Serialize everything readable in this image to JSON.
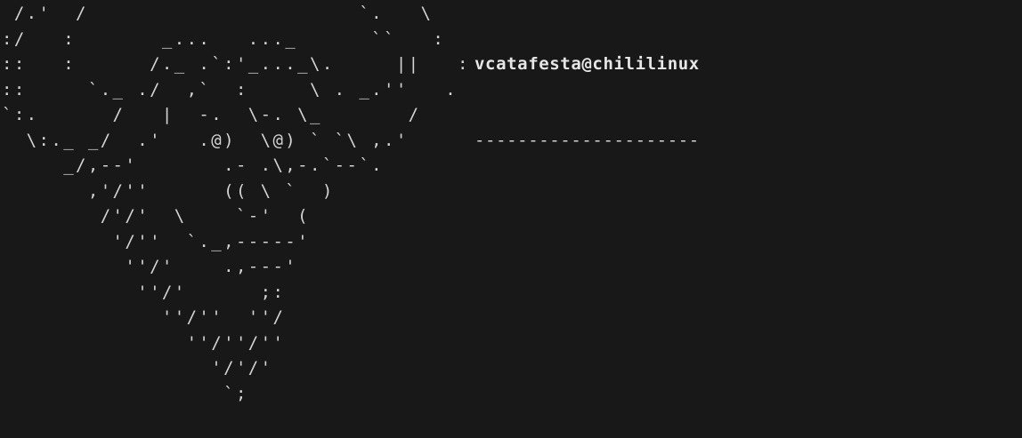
{
  "terminal": {
    "logo_lines": [
      " /.'  /                      `.   \\",
      ":/   :       _...   ..._      ``   :",
      "::   :      /._ .`:'_..._\\.     ||   :",
      "::     `._ ./  ,`  :     \\ . _.''   .",
      "`:.      /   |  -.  \\-. \\_       /",
      "  \\:._ _/  .'   .@)  \\@) ` `\\ ,.'",
      "     _/,--'       .- .\\,-.`--`.",
      "       ,'/''      (( \\ `  )",
      "        /'/'  \\    `-'  (",
      "         '/''  `._,-----'",
      "          ''/'    .,---'",
      "           ''/'      ;:",
      "             ''/''  ''/",
      "               ''/''/''",
      "                 '/'/'",
      "                  `;"
    ],
    "userhost": "vcatafesta@chililinux",
    "separator": "---------------------"
  }
}
